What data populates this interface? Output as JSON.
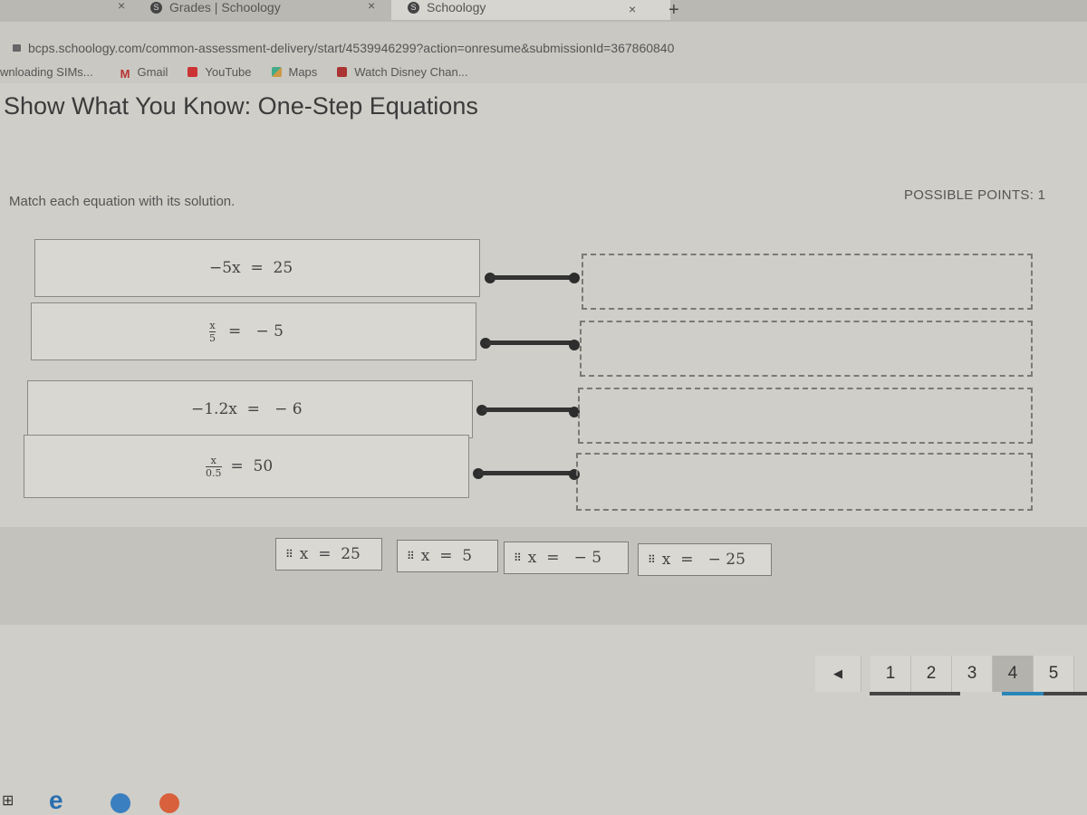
{
  "browser": {
    "tabs": [
      {
        "label": "Grades | Schoology",
        "active": false
      },
      {
        "label": "Schoology",
        "active": true
      }
    ],
    "url": "bcps.schoology.com/common-assessment-delivery/start/4539946299?action=onresume&submissionId=367860840",
    "bookmarks": [
      {
        "label": "wnloading SIMs...",
        "icon": "generic"
      },
      {
        "label": "Gmail",
        "icon": "gmail-icon"
      },
      {
        "label": "YouTube",
        "icon": "youtube-icon"
      },
      {
        "label": "Maps",
        "icon": "maps-icon"
      },
      {
        "label": "Watch Disney Chan...",
        "icon": "disney-icon"
      }
    ]
  },
  "assessment": {
    "title": "Show What You Know: One-Step Equations",
    "instructions": "Match each equation with its solution.",
    "possible_points": "POSSIBLE POINTS: 1",
    "equations": [
      {
        "text": "−5x  =  25"
      },
      {
        "num": "x",
        "den": "5",
        "rhs": "=   − 5"
      },
      {
        "text": "−1.2x  =   − 6"
      },
      {
        "num": "x",
        "den": "0.5",
        "rhs": "=  50"
      }
    ],
    "answers": [
      {
        "label": "x  =  25"
      },
      {
        "label": "x  =  5"
      },
      {
        "label": "x  =   − 5"
      },
      {
        "label": "x  =   − 25"
      }
    ]
  },
  "pagination": {
    "prev_icon": "◀",
    "pages": [
      "1",
      "2",
      "3",
      "4",
      "5"
    ],
    "current": "4",
    "answered": [
      "1",
      "2"
    ]
  },
  "colors": {
    "accent": "#2a86b8",
    "answered_bar": "#444444"
  }
}
